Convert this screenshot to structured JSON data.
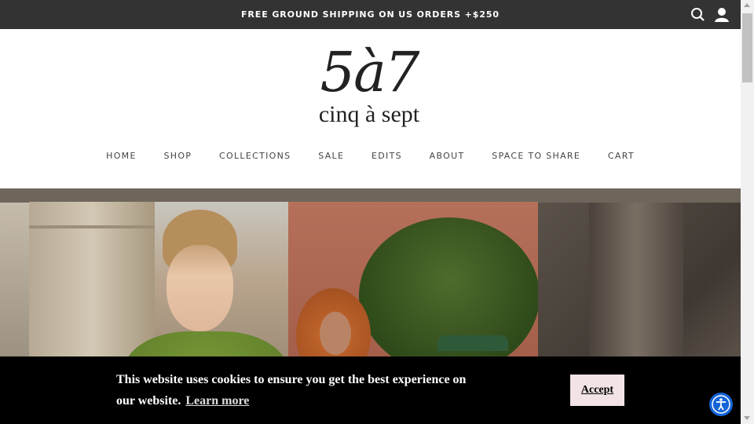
{
  "announcement": {
    "text": "FREE GROUND SHIPPING ON US ORDERS +$250"
  },
  "header_icons": {
    "search": "search-icon",
    "account": "user-icon"
  },
  "logo": {
    "number": "5à7",
    "wordmark": "cinq à sept"
  },
  "nav": {
    "items": [
      "HOME",
      "SHOP",
      "COLLECTIONS",
      "SALE",
      "EDITS",
      "ABOUT",
      "SPACE TO SHARE",
      "CART"
    ]
  },
  "cookie_banner": {
    "message": "This website uses cookies to ensure you get the best experience on our website.",
    "learn_more": "Learn more",
    "accept": "Accept"
  },
  "accessibility": {
    "icon": "accessibility-icon"
  },
  "colors": {
    "topbar": "#333333",
    "cookie_bg": "#000000",
    "accept_bg": "#f2e4e6",
    "a11y_blue": "#1565d8"
  }
}
